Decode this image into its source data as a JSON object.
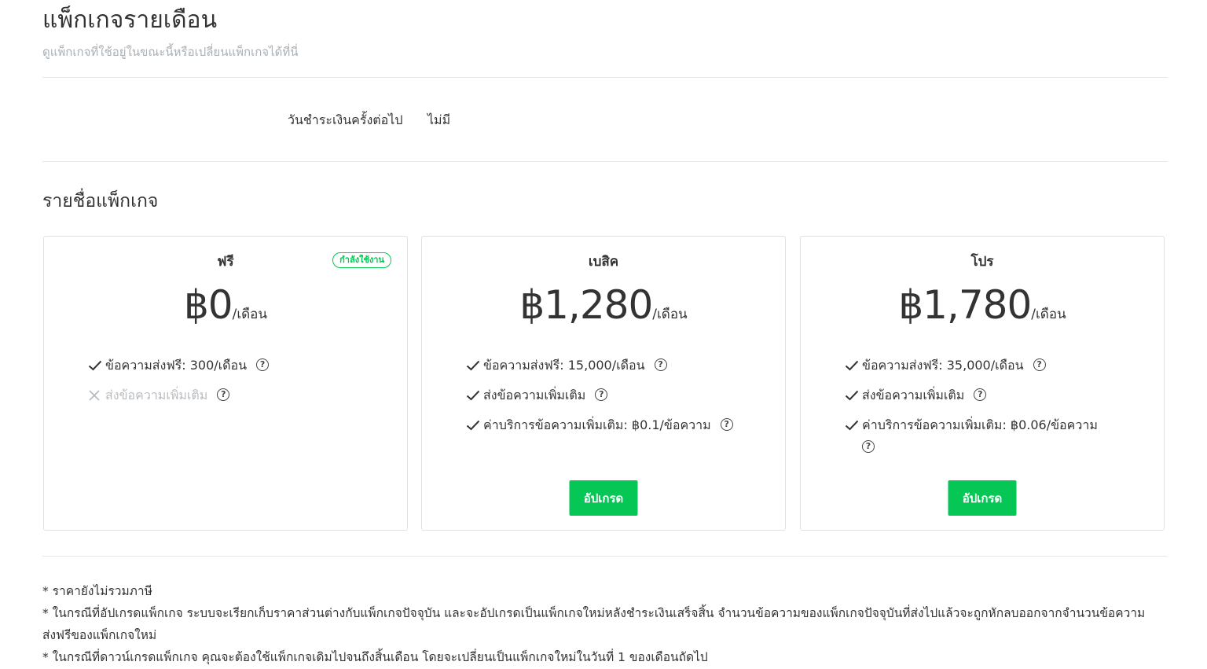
{
  "header": {
    "title": "แพ็กเกจรายเดือน",
    "subtitle": "ดูแพ็กเกจที่ใช้อยู่ในขณะนี้หรือเปลี่ยนแพ็กเกจได้ที่นี่"
  },
  "billing": {
    "label": "วันชำระเงินครั้งต่อไป",
    "value": "ไม่มี"
  },
  "section_title": "รายชื่อแพ็กเกจ",
  "packages": [
    {
      "name": "ฟรี",
      "badge": "กำลังใช้งาน",
      "price": "฿0",
      "per": "/เดือน",
      "features": [
        {
          "text": "ข้อความส่งฟรี: 300/เดือน",
          "enabled": true
        },
        {
          "text": "ส่งข้อความเพิ่มเติม",
          "enabled": false
        }
      ]
    },
    {
      "name": "เบสิค",
      "price": "฿1,280",
      "per": "/เดือน",
      "features": [
        {
          "text": "ข้อความส่งฟรี: 15,000/เดือน",
          "enabled": true
        },
        {
          "text": "ส่งข้อความเพิ่มเติม",
          "enabled": true
        },
        {
          "text": "ค่าบริการข้อความเพิ่มเติม: ฿0.1/ข้อความ",
          "enabled": true
        }
      ],
      "button": "อัปเกรด"
    },
    {
      "name": "โปร",
      "price": "฿1,780",
      "per": "/เดือน",
      "features": [
        {
          "text": "ข้อความส่งฟรี: 35,000/เดือน",
          "enabled": true
        },
        {
          "text": "ส่งข้อความเพิ่มเติม",
          "enabled": true
        },
        {
          "text": "ค่าบริการข้อความเพิ่มเติม: ฿0.06/ข้อความ",
          "enabled": true
        }
      ],
      "button": "อัปเกรด"
    }
  ],
  "notes": [
    "* ราคายังไม่รวมภาษี",
    "* ในกรณีที่อัปเกรดแพ็กเกจ ระบบจะเรียกเก็บราคาส่วนต่างกับแพ็กเกจปัจจุบัน และจะอัปเกรดเป็นแพ็กเกจใหม่หลังชำระเงินเสร็จสิ้น จำนวนข้อความของแพ็กเกจปัจจุบันที่ส่งไปแล้วจะถูกหักลบออกจากจำนวนข้อความส่งฟรีของแพ็กเกจใหม่",
    "* ในกรณีที่ดาวน์เกรดแพ็กเกจ คุณจะต้องใช้แพ็กเกจเดิมไปจนถึงสิ้นเดือน โดยจะเปลี่ยนเป็นแพ็กเกจใหม่ในวันที่ 1 ของเดือนถัดไป"
  ],
  "colors": {
    "accent": "#06c755",
    "text": "#333333",
    "muted": "#a9b0b6",
    "divider": "#e5e7ea"
  },
  "icons": {
    "check": "check-icon",
    "cross": "cross-icon",
    "help": "question-circle-icon"
  }
}
